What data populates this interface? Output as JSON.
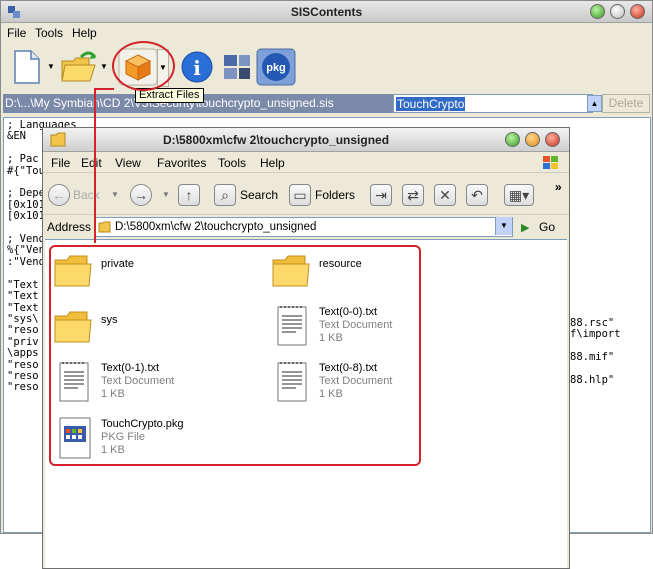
{
  "sis": {
    "title": "SISContents",
    "menu": [
      "File",
      "Tools",
      "Help"
    ],
    "path_text": "D:\\...\\My Symbian\\CD 2\\V5\\Security\\touchcrypto_unsigned.sis",
    "name_value": "TouchCrypto",
    "delete_label": "Delete",
    "pkg_icon_label": "pkg",
    "info_icon_label": "i",
    "text_lines": [
      "; Languages",
      "&EN",
      "",
      "; Pac",
      "#{\"Tou",
      "",
      "; Depe",
      "[0x101",
      "[0x101",
      "",
      "; Vend",
      "%{\"Ven",
      ":\"Vend",
      "",
      "\"Text",
      "\"Text",
      "\"Text",
      "\"sys\\",
      "\"reso",
      "\"priv",
      "\\apps",
      "\"reso",
      "\"reso",
      "\"reso"
    ],
    "text_right": [
      "88.rsc\"",
      "f\\import",
      "",
      "88.mif\"",
      "",
      "88.hlp\""
    ]
  },
  "tooltip": "Extract Files",
  "explorer": {
    "title": "D:\\5800xm\\cfw 2\\touchcrypto_unsigned",
    "menu": [
      "File",
      "Edit",
      "View",
      "Favorites",
      "Tools",
      "Help"
    ],
    "back_label": "Back",
    "search_label": "Search",
    "folders_label": "Folders",
    "address_label": "Address",
    "address_value": "D:\\5800xm\\cfw 2\\touchcrypto_unsigned",
    "go_label": "Go",
    "items": [
      {
        "name": "private",
        "type": "",
        "size": "",
        "icon": "folder-icon"
      },
      {
        "name": "resource",
        "type": "",
        "size": "",
        "icon": "folder-icon"
      },
      {
        "name": "sys",
        "type": "",
        "size": "",
        "icon": "folder-icon"
      },
      {
        "name": "Text(0-0).txt",
        "type": "Text Document",
        "size": "1 KB",
        "icon": "text-document-icon"
      },
      {
        "name": "Text(0-1).txt",
        "type": "Text Document",
        "size": "1 KB",
        "icon": "text-document-icon"
      },
      {
        "name": "Text(0-8).txt",
        "type": "Text Document",
        "size": "1 KB",
        "icon": "text-document-icon"
      },
      {
        "name": "TouchCrypto.pkg",
        "type": "PKG File",
        "size": "1 KB",
        "icon": "pkg-file-icon"
      }
    ]
  },
  "colors": {
    "annotation_red": "#d2222a",
    "selection_blue": "#316ac5",
    "path_bar": "#7b8aa9"
  }
}
